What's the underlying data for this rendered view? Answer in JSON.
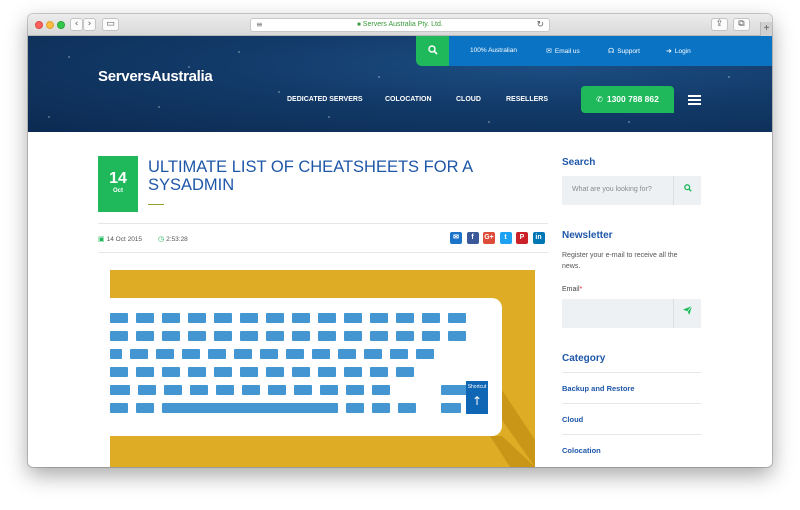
{
  "browser": {
    "url_text": "Servers Australia Pty. Ltd.",
    "new_tab": "+"
  },
  "header": {
    "logo": "ServersAustralia",
    "top_links": [
      "100% Australian",
      "Email us",
      "Support",
      "Login"
    ],
    "nav": [
      "DEDICATED SERVERS",
      "COLOCATION",
      "CLOUD",
      "RESELLERS"
    ],
    "phone": "1300 788 862"
  },
  "post": {
    "date_day": "14",
    "date_month": "Oct",
    "title": "ULTIMATE LIST OF CHEATSHEETS FOR A SYSADMIN",
    "meta_date": "14 Oct 2015",
    "meta_time": "2:53:28",
    "share": [
      {
        "name": "email",
        "glyph": "✉",
        "color": "#1a73c8"
      },
      {
        "name": "facebook",
        "glyph": "f",
        "color": "#3b5998"
      },
      {
        "name": "google-plus",
        "glyph": "G+",
        "color": "#dd4b39"
      },
      {
        "name": "twitter",
        "glyph": "t",
        "color": "#1da1f2"
      },
      {
        "name": "pinterest",
        "glyph": "P",
        "color": "#cb2027"
      },
      {
        "name": "linkedin",
        "glyph": "in",
        "color": "#0077b5"
      }
    ],
    "hero_key_label": "Shortcut",
    "hero_arrow": "↑"
  },
  "sidebar": {
    "search_heading": "Search",
    "search_placeholder": "What are you looking for?",
    "newsletter_heading": "Newsletter",
    "newsletter_text": "Register your e-mail to receive all the news.",
    "email_label": "Email",
    "email_required": "*",
    "category_heading": "Category",
    "categories": [
      "Backup and Restore",
      "Cloud",
      "Colocation"
    ]
  },
  "colors": {
    "brand_blue": "#1e57a8",
    "accent_green": "#1fb95c",
    "topbar_blue": "#0a73c4",
    "hero_yellow": "#dfad25",
    "key_blue": "#4496d2"
  }
}
